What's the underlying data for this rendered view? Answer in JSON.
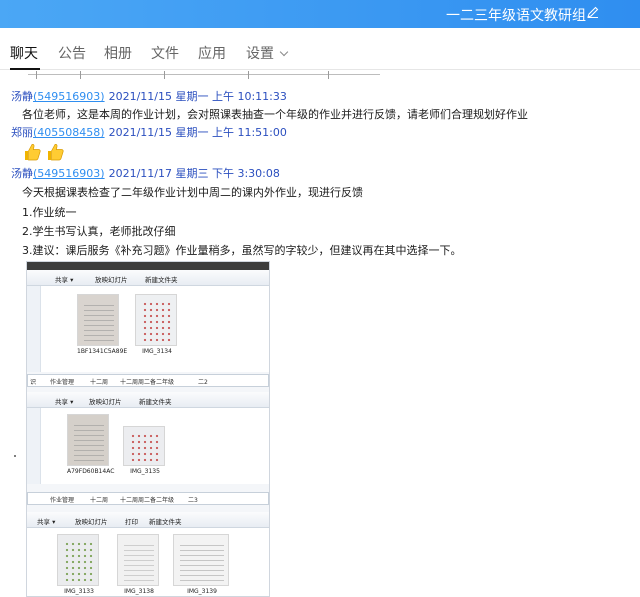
{
  "window": {
    "title": "一二三年级语文教研组",
    "edit_icon": "pencil-icon",
    "accent": "#2f8ef0"
  },
  "tabs": [
    {
      "label": "聊天",
      "active": true
    },
    {
      "label": "公告",
      "active": false
    },
    {
      "label": "相册",
      "active": false
    },
    {
      "label": "文件",
      "active": false
    },
    {
      "label": "应用",
      "active": false
    },
    {
      "label": "设置",
      "active": false,
      "dropdown": "chevron-down-icon"
    }
  ],
  "messages": [
    {
      "name": "汤静",
      "qq": "(549516903)",
      "time": "2021/11/15 星期一 上午 10:11:33",
      "lines": [
        "各位老师，这是本周的作业计划，会对照课表抽查一个年级的作业并进行反馈，请老师们合理规划好作业"
      ]
    },
    {
      "name": "郑丽",
      "qq": "(405508458)",
      "time": "2021/11/15 星期一 上午 11:51:00",
      "emoji": "thumbs-up-icon"
    },
    {
      "name": "汤静",
      "qq": "(549516903)",
      "time": "2021/11/17 星期三 下午 3:30:08",
      "lines": [
        "今天根据课表检查了二年级作业计划中周二的课内外作业，现进行反馈",
        "1.作业统一",
        "2.学生书写认真，老师批改仔细",
        "3.建议：课后服务《补充习题》作业量稍多，虽然写的字较少，但建议再在其中选择一下。"
      ]
    }
  ],
  "screenshot": {
    "toolbar1": [
      "共享 ▾",
      "放映幻灯片",
      "新建文件夹"
    ],
    "files1": [
      "1BF1341C5A89E",
      "IMG_3134"
    ],
    "path1": [
      "识",
      "作业管理",
      "十二周",
      "十二周周二备二年级",
      "二2"
    ],
    "toolbar2": [
      "共享 ▾",
      "放映幻灯片",
      "新建文件夹"
    ],
    "files2": [
      "A79FD60B14AC",
      "IMG_3135"
    ],
    "path2": [
      "作业管理",
      "十二周",
      "十二周周二备二年级",
      "二3"
    ],
    "toolbar3": [
      "共享 ▾",
      "放映幻灯片",
      "打印",
      "新建文件夹"
    ],
    "files3": [
      "IMG_3133",
      "IMG_3138",
      "IMG_3139"
    ]
  }
}
